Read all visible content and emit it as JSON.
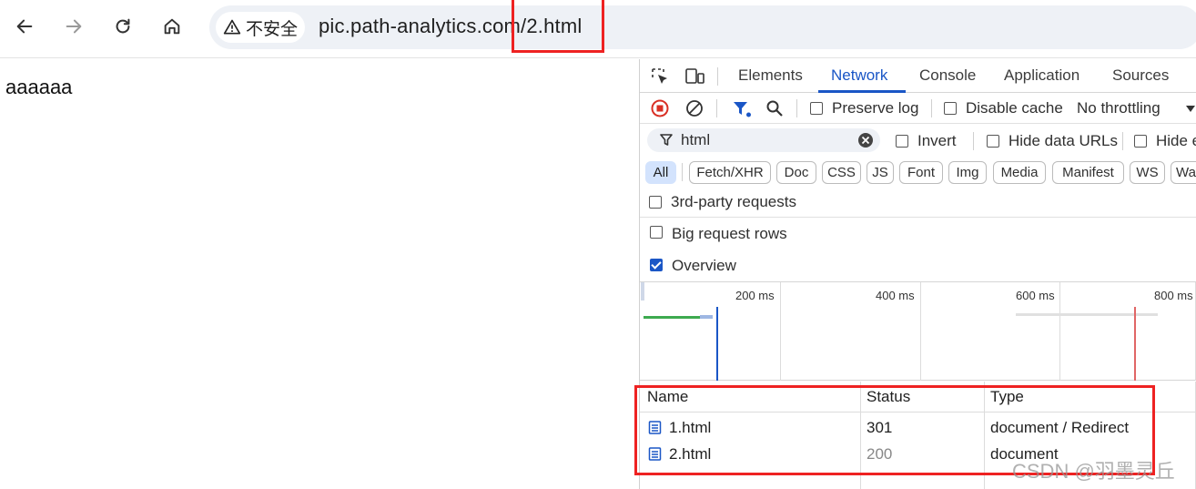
{
  "browser": {
    "security_label": "不安全",
    "url": "pic.path-analytics.com/2.html"
  },
  "page": {
    "text": "aaaaaa"
  },
  "devtools": {
    "tabs": [
      "Elements",
      "Network",
      "Console",
      "Application",
      "Sources"
    ],
    "active_tab": "Network",
    "toolbar": {
      "preserve_log": "Preserve log",
      "disable_cache": "Disable cache",
      "throttling": "No throttling"
    },
    "filter": {
      "value": "html",
      "invert": "Invert",
      "hide_data_urls": "Hide data URLs",
      "hide_extension": "Hide e"
    },
    "types": [
      "All",
      "Fetch/XHR",
      "Doc",
      "CSS",
      "JS",
      "Font",
      "Img",
      "Media",
      "Manifest",
      "WS",
      "Wa"
    ],
    "active_type": "All",
    "options": {
      "third_party": "3rd-party requests",
      "big_rows": "Big request rows",
      "overview": "Overview"
    },
    "overview_ticks": [
      "200 ms",
      "400 ms",
      "600 ms",
      "800 ms"
    ],
    "table": {
      "headers": [
        "Name",
        "Status",
        "Type"
      ],
      "rows": [
        {
          "name": "1.html",
          "status": "301",
          "type": "document / Redirect"
        },
        {
          "name": "2.html",
          "status": "200",
          "type": "document"
        }
      ]
    }
  },
  "watermark": "CSDN @羽墨灵丘",
  "colors": {
    "accent": "#1a56c6",
    "highlight": "#ee2222",
    "status_muted": "#888888"
  }
}
